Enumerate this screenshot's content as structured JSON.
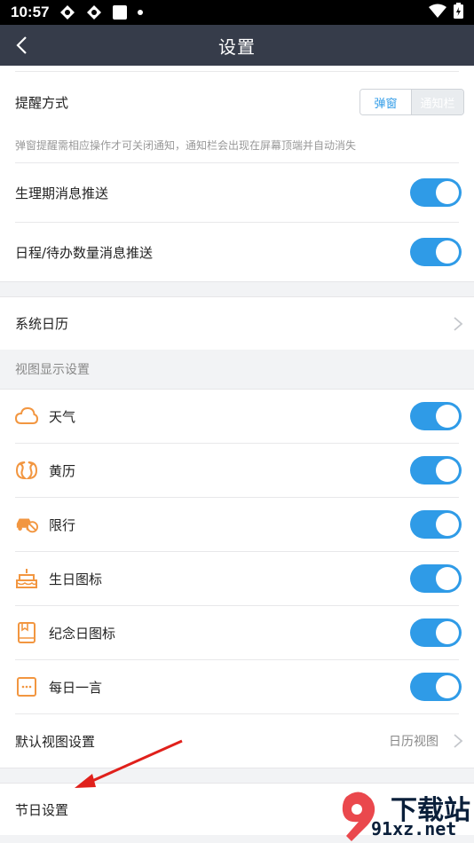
{
  "status_bar": {
    "time": "10:57"
  },
  "app_bar": {
    "title": "设置"
  },
  "reminder": {
    "label": "提醒方式",
    "options": [
      "弹窗",
      "通知栏"
    ],
    "hint": "弹窗提醒需相应操作才可关闭通知，通知栏会出现在屏幕顶端并自动消失"
  },
  "notifications": [
    {
      "label": "生理期消息推送",
      "enabled": true
    },
    {
      "label": "日程/待办数量消息推送",
      "enabled": true
    }
  ],
  "system_calendar": {
    "label": "系统日历"
  },
  "view_settings": {
    "header": "视图显示设置",
    "items": [
      {
        "label": "天气",
        "icon": "cloud-icon",
        "enabled": true
      },
      {
        "label": "黄历",
        "icon": "almanac-icon",
        "enabled": true
      },
      {
        "label": "限行",
        "icon": "car-restriction-icon",
        "enabled": true
      },
      {
        "label": "生日图标",
        "icon": "cake-icon",
        "enabled": true
      },
      {
        "label": "纪念日图标",
        "icon": "anniversary-book-icon",
        "enabled": true
      },
      {
        "label": "每日一言",
        "icon": "quote-icon",
        "enabled": true
      }
    ],
    "default_view": {
      "label": "默认视图设置",
      "value": "日历视图"
    }
  },
  "holiday": {
    "label": "节日设置"
  },
  "watermark": {
    "top": "下载站",
    "bottom": "91xz.net"
  },
  "colors": {
    "accent": "#2f9be7",
    "icon_orange": "#f29640",
    "app_bar": "#363c4a",
    "arrow": "#e0201b"
  }
}
